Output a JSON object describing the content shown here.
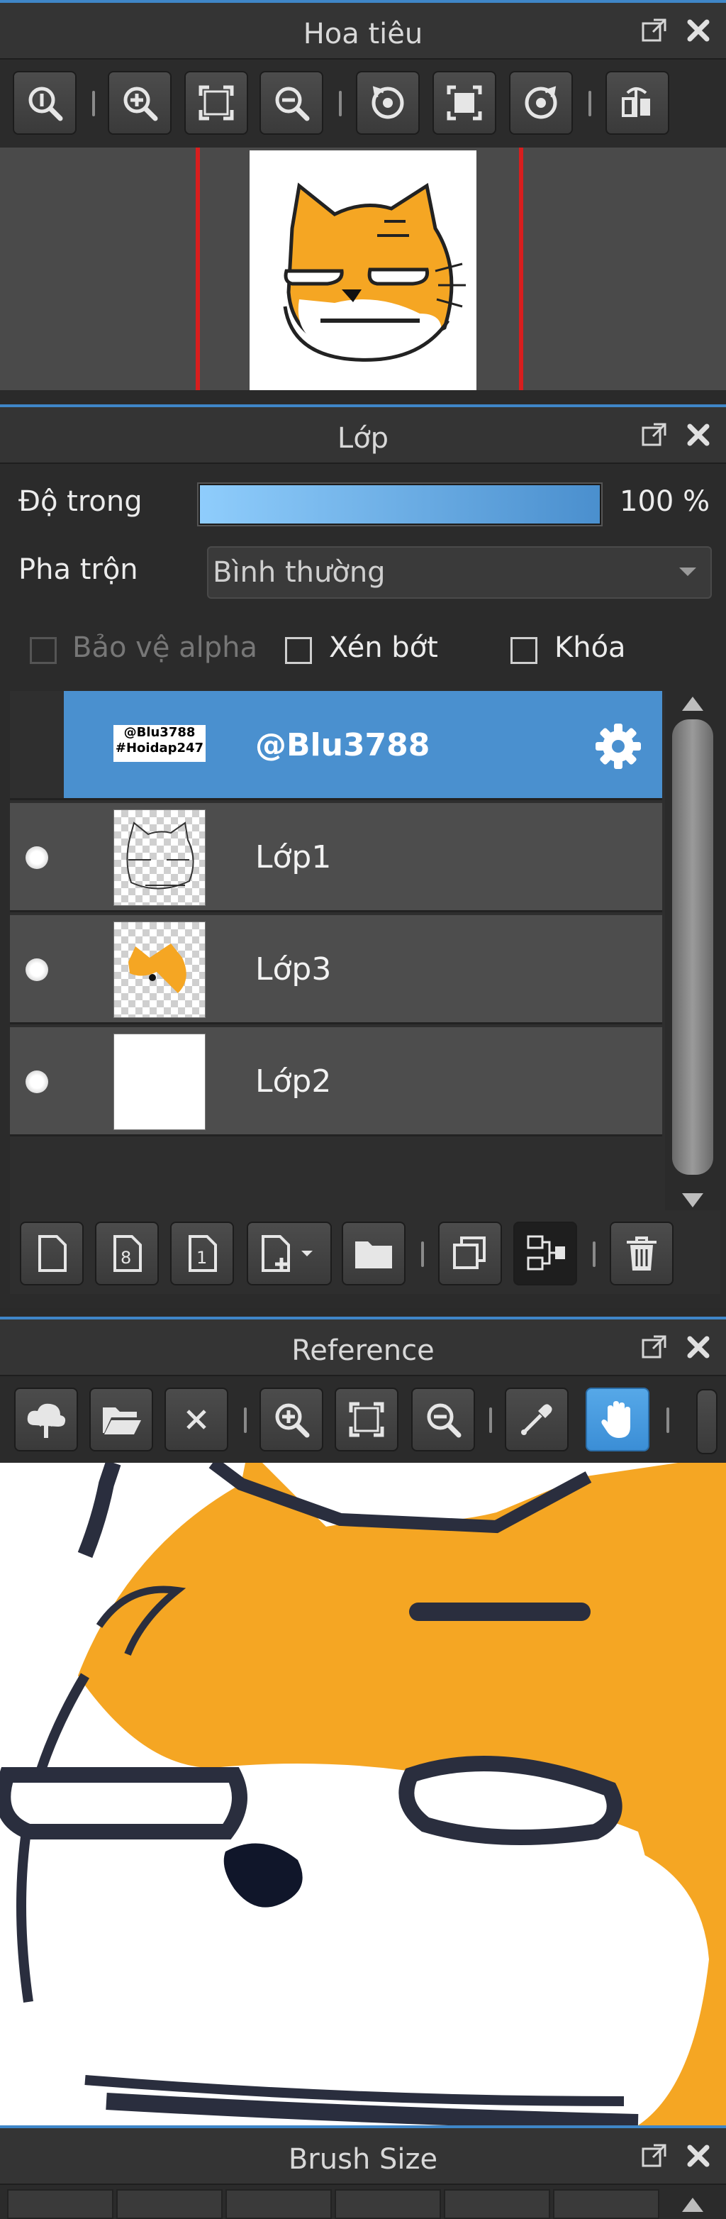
{
  "navigator": {
    "title": "Hoa tiêu",
    "toolbar_icons": [
      "zoom-100-icon",
      "zoom-in-icon",
      "fit-icon",
      "zoom-out-icon",
      "rotate-left-icon",
      "reset-view-icon",
      "rotate-right-icon",
      "flip-icon"
    ]
  },
  "layers": {
    "title": "Lớp",
    "opacity_label": "Độ trong",
    "opacity_value": "100 %",
    "opacity_fraction": 1.0,
    "blend_label": "Pha trộn",
    "blend_value": "Bình thường",
    "protect_alpha_label": "Bảo vệ alpha",
    "clip_label": "Xén bớt",
    "lock_label": "Khóa",
    "items": [
      {
        "name": "@Blu3788",
        "thumb_text_1": "@Blu3788",
        "thumb_text_2": "#Hoidap247",
        "selected": true
      },
      {
        "name": "Lớp1",
        "selected": false
      },
      {
        "name": "Lớp3",
        "selected": false
      },
      {
        "name": "Lớp2",
        "selected": false
      }
    ]
  },
  "reference": {
    "title": "Reference"
  },
  "brush_size": {
    "title": "Brush Size"
  },
  "colors": {
    "accent": "#3f86c8",
    "selection": "#4a90cf",
    "orange": "#f5a623",
    "red_frame": "#d81e1e"
  }
}
